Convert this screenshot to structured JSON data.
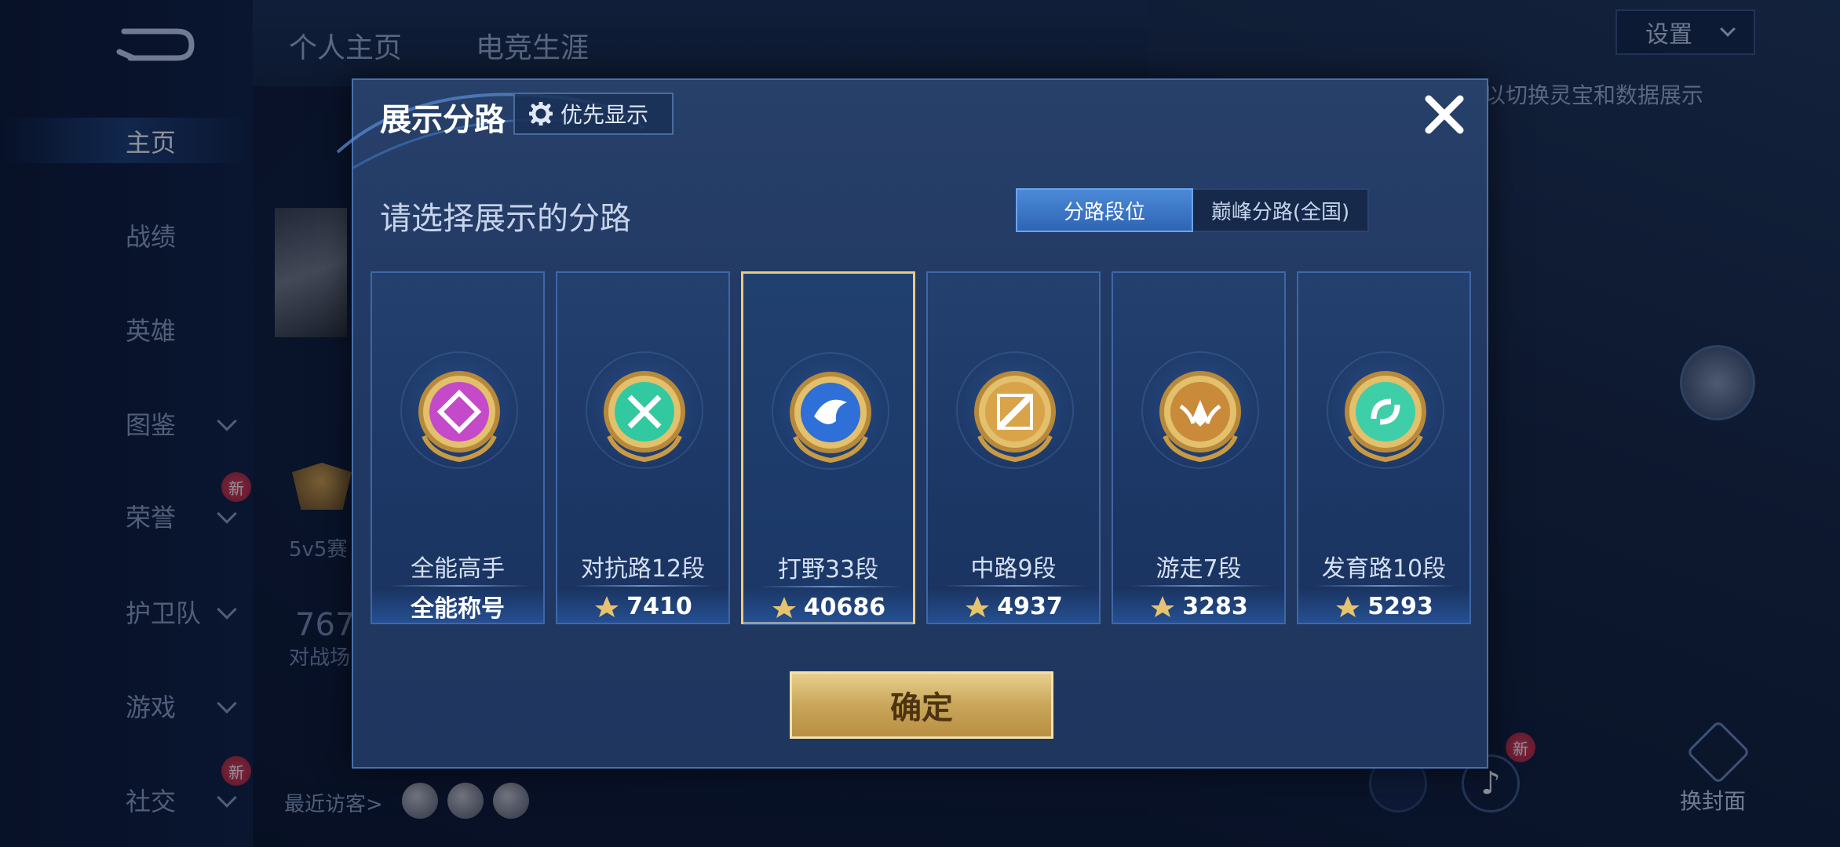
{
  "nav": {
    "items": [
      {
        "label": "主页",
        "active": true,
        "chevron": false,
        "badge": ""
      },
      {
        "label": "战绩",
        "active": false,
        "chevron": false,
        "badge": ""
      },
      {
        "label": "英雄",
        "active": false,
        "chevron": false,
        "badge": ""
      },
      {
        "label": "图鉴",
        "active": false,
        "chevron": true,
        "badge": ""
      },
      {
        "label": "荣誉",
        "active": false,
        "chevron": true,
        "badge": "新"
      },
      {
        "label": "护卫队",
        "active": false,
        "chevron": true,
        "badge": ""
      },
      {
        "label": "游戏",
        "active": false,
        "chevron": true,
        "badge": ""
      },
      {
        "label": "社交",
        "active": false,
        "chevron": true,
        "badge": "新"
      }
    ]
  },
  "profile": {
    "tabs": [
      "个人主页",
      "电竞生涯"
    ],
    "mode_text": "5v5赛",
    "stat_value": "767",
    "stat_label": "对战场",
    "visitors_label": "最近访客>"
  },
  "right_panel": {
    "settings_label": "设置",
    "switch_hint": "以切换灵宝和数据展示",
    "cover_label": "换封面",
    "tiktok_badge": "新"
  },
  "modal": {
    "title": "展示分路",
    "priority_label": "优先显示",
    "prompt": "请选择展示的分路",
    "segments": {
      "rank": "分路段位",
      "peak": "巅峰分路(全国)"
    },
    "selected_segment": "rank",
    "cards": [
      {
        "name": "全能高手",
        "footer": "全能称号",
        "show_points_icon": false,
        "selected": false,
        "emblem": "all-round-emblem-icon",
        "color": "#c54ac9"
      },
      {
        "name": "对抗路12段",
        "footer": "7410",
        "show_points_icon": true,
        "selected": false,
        "emblem": "clash-lane-emblem-icon",
        "color": "#33c9a0"
      },
      {
        "name": "打野33段",
        "footer": "40686",
        "show_points_icon": true,
        "selected": true,
        "emblem": "jungle-emblem-icon",
        "color": "#2e6fd8"
      },
      {
        "name": "中路9段",
        "footer": "4937",
        "show_points_icon": true,
        "selected": false,
        "emblem": "mid-lane-emblem-icon",
        "color": "#d9a34a"
      },
      {
        "name": "游走7段",
        "footer": "3283",
        "show_points_icon": true,
        "selected": false,
        "emblem": "roam-emblem-icon",
        "color": "#c98a3a"
      },
      {
        "name": "发育路10段",
        "footer": "5293",
        "show_points_icon": true,
        "selected": false,
        "emblem": "farm-lane-emblem-icon",
        "color": "#3ecfa8"
      }
    ],
    "confirm_label": "确定"
  }
}
